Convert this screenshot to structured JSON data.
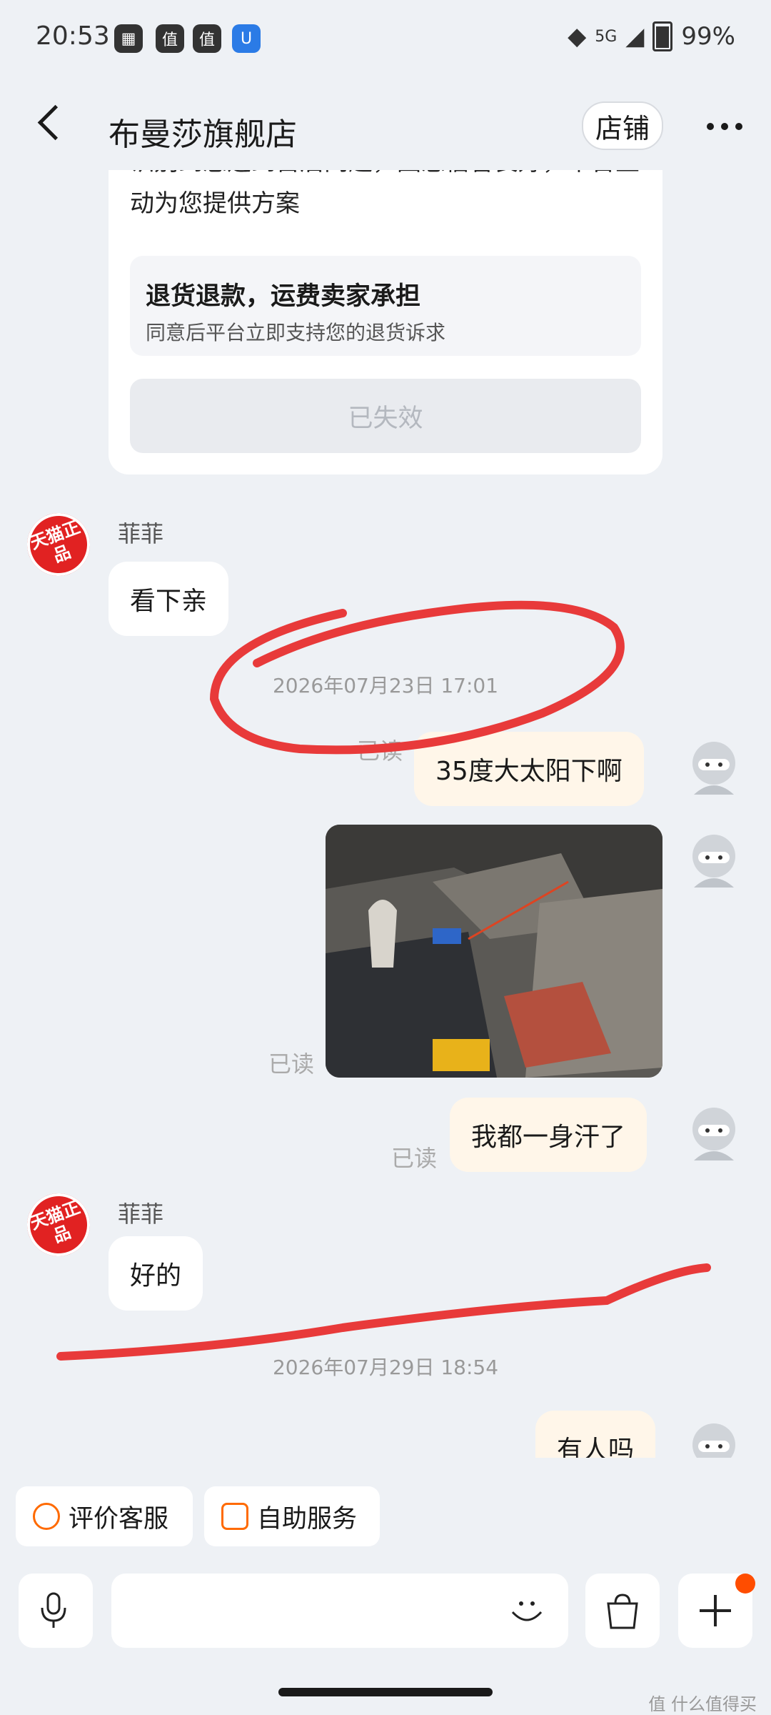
{
  "status": {
    "time": "20:53",
    "network": "5G",
    "battery": "99%",
    "icons": [
      "calendar-icon",
      "zhi-icon",
      "zhi-icon",
      "app-icon"
    ]
  },
  "header": {
    "title": "布曼莎旗舰店",
    "shop_button": "店铺"
  },
  "card": {
    "text": "识别到您遇到售后问题，因您信誉良好，平台主动为您提供方案",
    "option_title": "退货退款，运费卖家承担",
    "option_sub": "同意后平台立即支持您的退货诉求",
    "button": "已失效"
  },
  "messages": {
    "shop_name": "菲菲",
    "shop_avatar_text": "天猫正品",
    "m1": "看下亲",
    "ts1": "2026年07月23日 17:01",
    "m2": "35度大太阳下啊",
    "read": "已读",
    "m4": "我都一身汗了",
    "m5": "好的",
    "ts2": "2026年07月29日 18:54",
    "m6": "有人吗"
  },
  "quick_actions": {
    "rate": "评价客服",
    "self_service": "自助服务"
  },
  "colors": {
    "accent": "#ff6a00",
    "annotation": "#e83a3a",
    "bubble_user": "#fff6e9"
  },
  "watermark": "值 什么值得买"
}
